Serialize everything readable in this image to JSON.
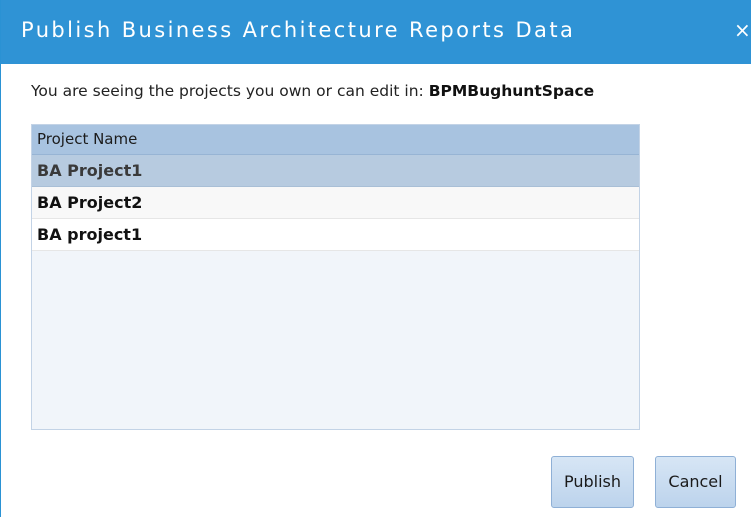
{
  "dialog": {
    "title": "Publish Business Architecture Reports Data",
    "close_glyph": "×"
  },
  "info": {
    "prefix": "You are seeing the projects you own or can edit in: ",
    "space_name": "BPMBughuntSpace"
  },
  "grid": {
    "column_header": "Project Name",
    "rows": [
      {
        "name": "BA Project1",
        "selected": true
      },
      {
        "name": "BA Project2",
        "selected": false
      },
      {
        "name": "BA project1",
        "selected": false
      }
    ]
  },
  "buttons": {
    "publish_label": "Publish",
    "cancel_label": "Cancel"
  },
  "colors": {
    "titlebar": "#2f93d5",
    "header": "#a8c3e0",
    "selected_row": "#b7cbe0",
    "button": "#c9dcf0"
  }
}
